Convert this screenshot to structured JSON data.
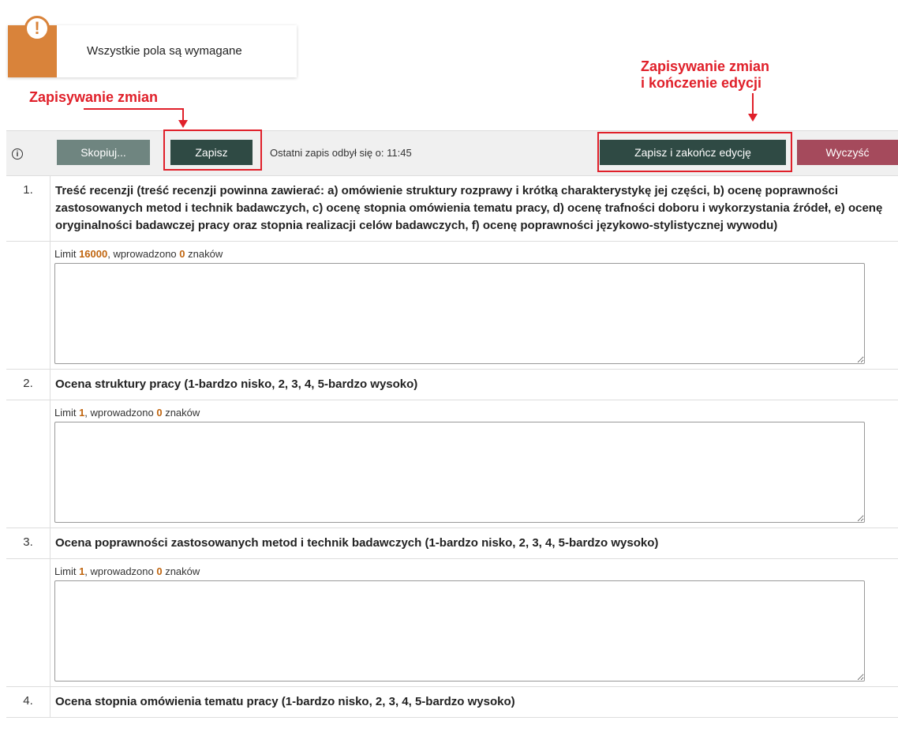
{
  "notice": {
    "text": "Wszystkie pola są wymagane",
    "icon": "exclamation-icon",
    "color": "#d9833a"
  },
  "annotations": {
    "save": "Zapisywanie zmian",
    "save_finish_line1": "Zapisywanie zmian",
    "save_finish_line2": "i kończenie edycji",
    "color": "#e0202a"
  },
  "toolbar": {
    "info_icon": "info-icon",
    "copy_label": "Skopiuj...",
    "save_label": "Zapisz",
    "last_save": "Ostatni zapis odbył się o: 11:45",
    "save_finish_label": "Zapisz i zakończ edycję",
    "clear_label": "Wyczyść"
  },
  "questions": [
    {
      "num": "1.",
      "title": "Treść recenzji (treść recenzji powinna zawierać: a) omówienie struktury rozprawy i krótką charakterystykę jej części, b) ocenę poprawności zastosowanych metod i technik badawczych, c) ocenę stopnia omówienia tematu pracy, d) ocenę trafności doboru i wykorzystania źródeł, e) ocenę oryginalności badawczej pracy oraz stopnia realizacji celów badawczych, f) ocenę poprawności językowo-stylistycznej wywodu)",
      "limit_prefix": "Limit ",
      "limit": "16000",
      "entered_prefix": ", wprowadzono ",
      "entered": "0",
      "entered_suffix": " znaków",
      "value": ""
    },
    {
      "num": "2.",
      "title": "Ocena struktury pracy (1-bardzo nisko, 2, 3, 4, 5-bardzo wysoko)",
      "limit_prefix": "Limit ",
      "limit": "1",
      "entered_prefix": ", wprowadzono ",
      "entered": "0",
      "entered_suffix": " znaków",
      "value": ""
    },
    {
      "num": "3.",
      "title": "Ocena poprawności zastosowanych metod i technik badawczych (1-bardzo nisko, 2, 3, 4, 5-bardzo wysoko)",
      "limit_prefix": "Limit ",
      "limit": "1",
      "entered_prefix": ", wprowadzono ",
      "entered": "0",
      "entered_suffix": " znaków",
      "value": ""
    },
    {
      "num": "4.",
      "title": "Ocena stopnia omówienia tematu pracy (1-bardzo nisko, 2, 3, 4, 5-bardzo wysoko)"
    }
  ]
}
